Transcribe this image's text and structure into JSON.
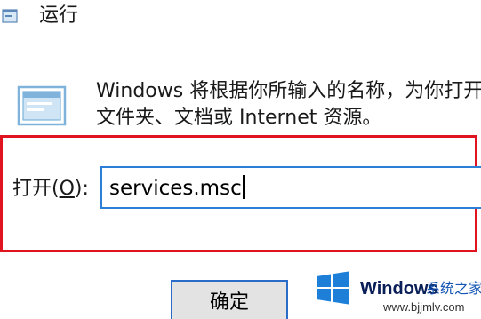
{
  "window": {
    "title": "运行",
    "title_icon": "run-dialog-icon"
  },
  "body": {
    "icon": "run-dialog-icon",
    "description_line1": "Windows 将根据你所输入的名称，为你打开",
    "description_line2": "文件夹、文档或 Internet 资源。"
  },
  "open_field": {
    "label_prefix": "打开(",
    "label_hotkey": "O",
    "label_suffix": "):",
    "value": "services.msc"
  },
  "buttons": {
    "ok_label": "确定"
  },
  "highlight": {
    "color": "#e0141e"
  },
  "watermark": {
    "logo": "windows-logo-icon",
    "brand": "Windows",
    "brand_cn": "系统之家",
    "url": "www.bjjmlv.com"
  },
  "colors": {
    "focus_border": "#2b7fd6",
    "brand_blue": "#0a1e57",
    "windows_logo": "#1d7fd8"
  }
}
